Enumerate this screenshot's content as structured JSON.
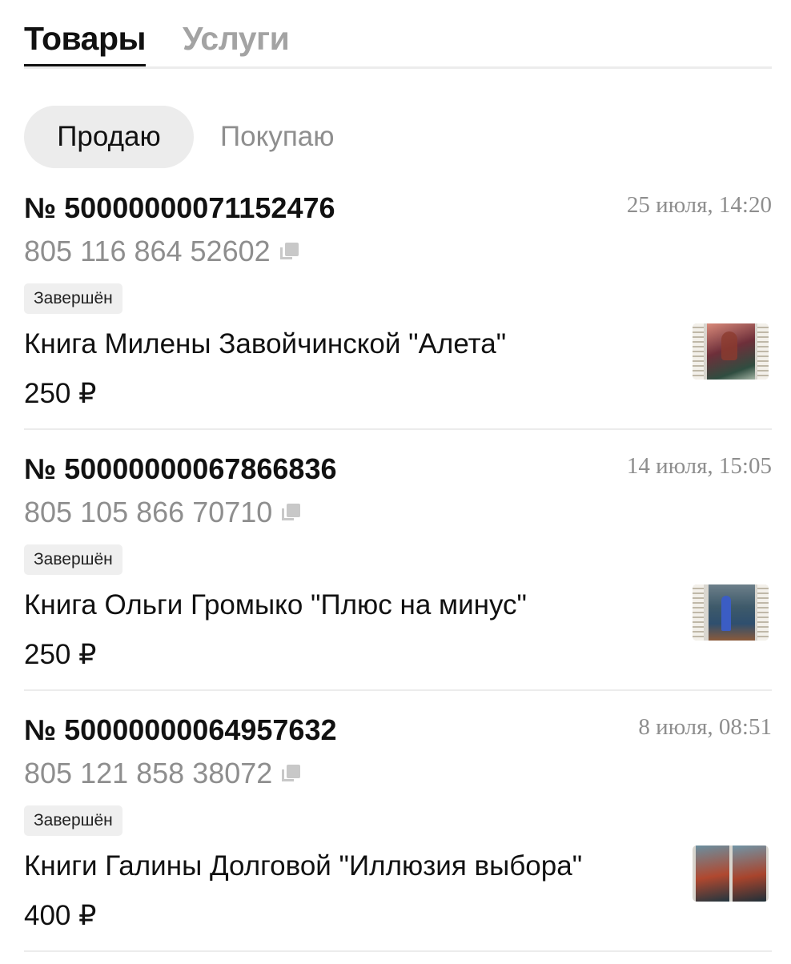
{
  "main_tabs": [
    {
      "label": "Товары",
      "active": true
    },
    {
      "label": "Услуги",
      "active": false
    }
  ],
  "sub_tabs": [
    {
      "label": "Продаю",
      "active": true
    },
    {
      "label": "Покупаю",
      "active": false
    }
  ],
  "orders": [
    {
      "number": "№ 50000000071152476",
      "date": "25 июля, 14:20",
      "track": "805 116 864 52602",
      "status": "Завершён",
      "title": "Книга Милены Завойчинской \"Алета\"",
      "price": "250 ₽",
      "thumb_icon": "book-cover-thumbnail"
    },
    {
      "number": "№ 50000000067866836",
      "date": "14 июля, 15:05",
      "track": "805 105 866 70710",
      "status": "Завершён",
      "title": "Книга Ольги Громыко \"Плюс на минус\"",
      "price": "250 ₽",
      "thumb_icon": "book-cover-thumbnail"
    },
    {
      "number": "№ 50000000064957632",
      "date": "8 июля, 08:51",
      "track": "805 121 858 38072",
      "status": "Завершён",
      "title": "Книги Галины Долговой \"Иллюзия выбора\"",
      "price": "400 ₽",
      "thumb_icon": "book-covers-thumbnail"
    }
  ],
  "colors": {
    "text_primary": "#111111",
    "text_secondary": "#8e8e8e",
    "tab_inactive": "#a3a3a3",
    "pill_bg": "#ececec",
    "badge_bg": "#efefef",
    "divider": "#ececec"
  }
}
